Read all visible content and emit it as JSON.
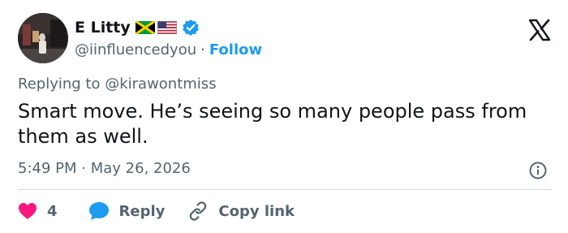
{
  "header": {
    "display_name": "E Litty",
    "handle": "@iinfluencedyou",
    "separator": "·",
    "follow_label": "Follow"
  },
  "tweet": {
    "reply_prefix": "Replying to",
    "reply_mention": "@kirawontmiss",
    "text": "Smart move. He’s seeing so many people pass from them as well.",
    "time": "5:49 PM",
    "separator": "·",
    "date": "May 26, 2026"
  },
  "actions": {
    "like_count": "4",
    "reply_label": "Reply",
    "copy_label": "Copy link"
  },
  "colors": {
    "link_blue": "#1d9bf0",
    "heart_pink": "#f91880",
    "muted": "#536471",
    "text": "#0f1419"
  },
  "icons": [
    "jamaica-flag-icon",
    "us-flag-icon",
    "verified-badge-icon",
    "x-logo-icon",
    "info-icon",
    "heart-icon",
    "reply-bubble-icon",
    "link-icon"
  ]
}
